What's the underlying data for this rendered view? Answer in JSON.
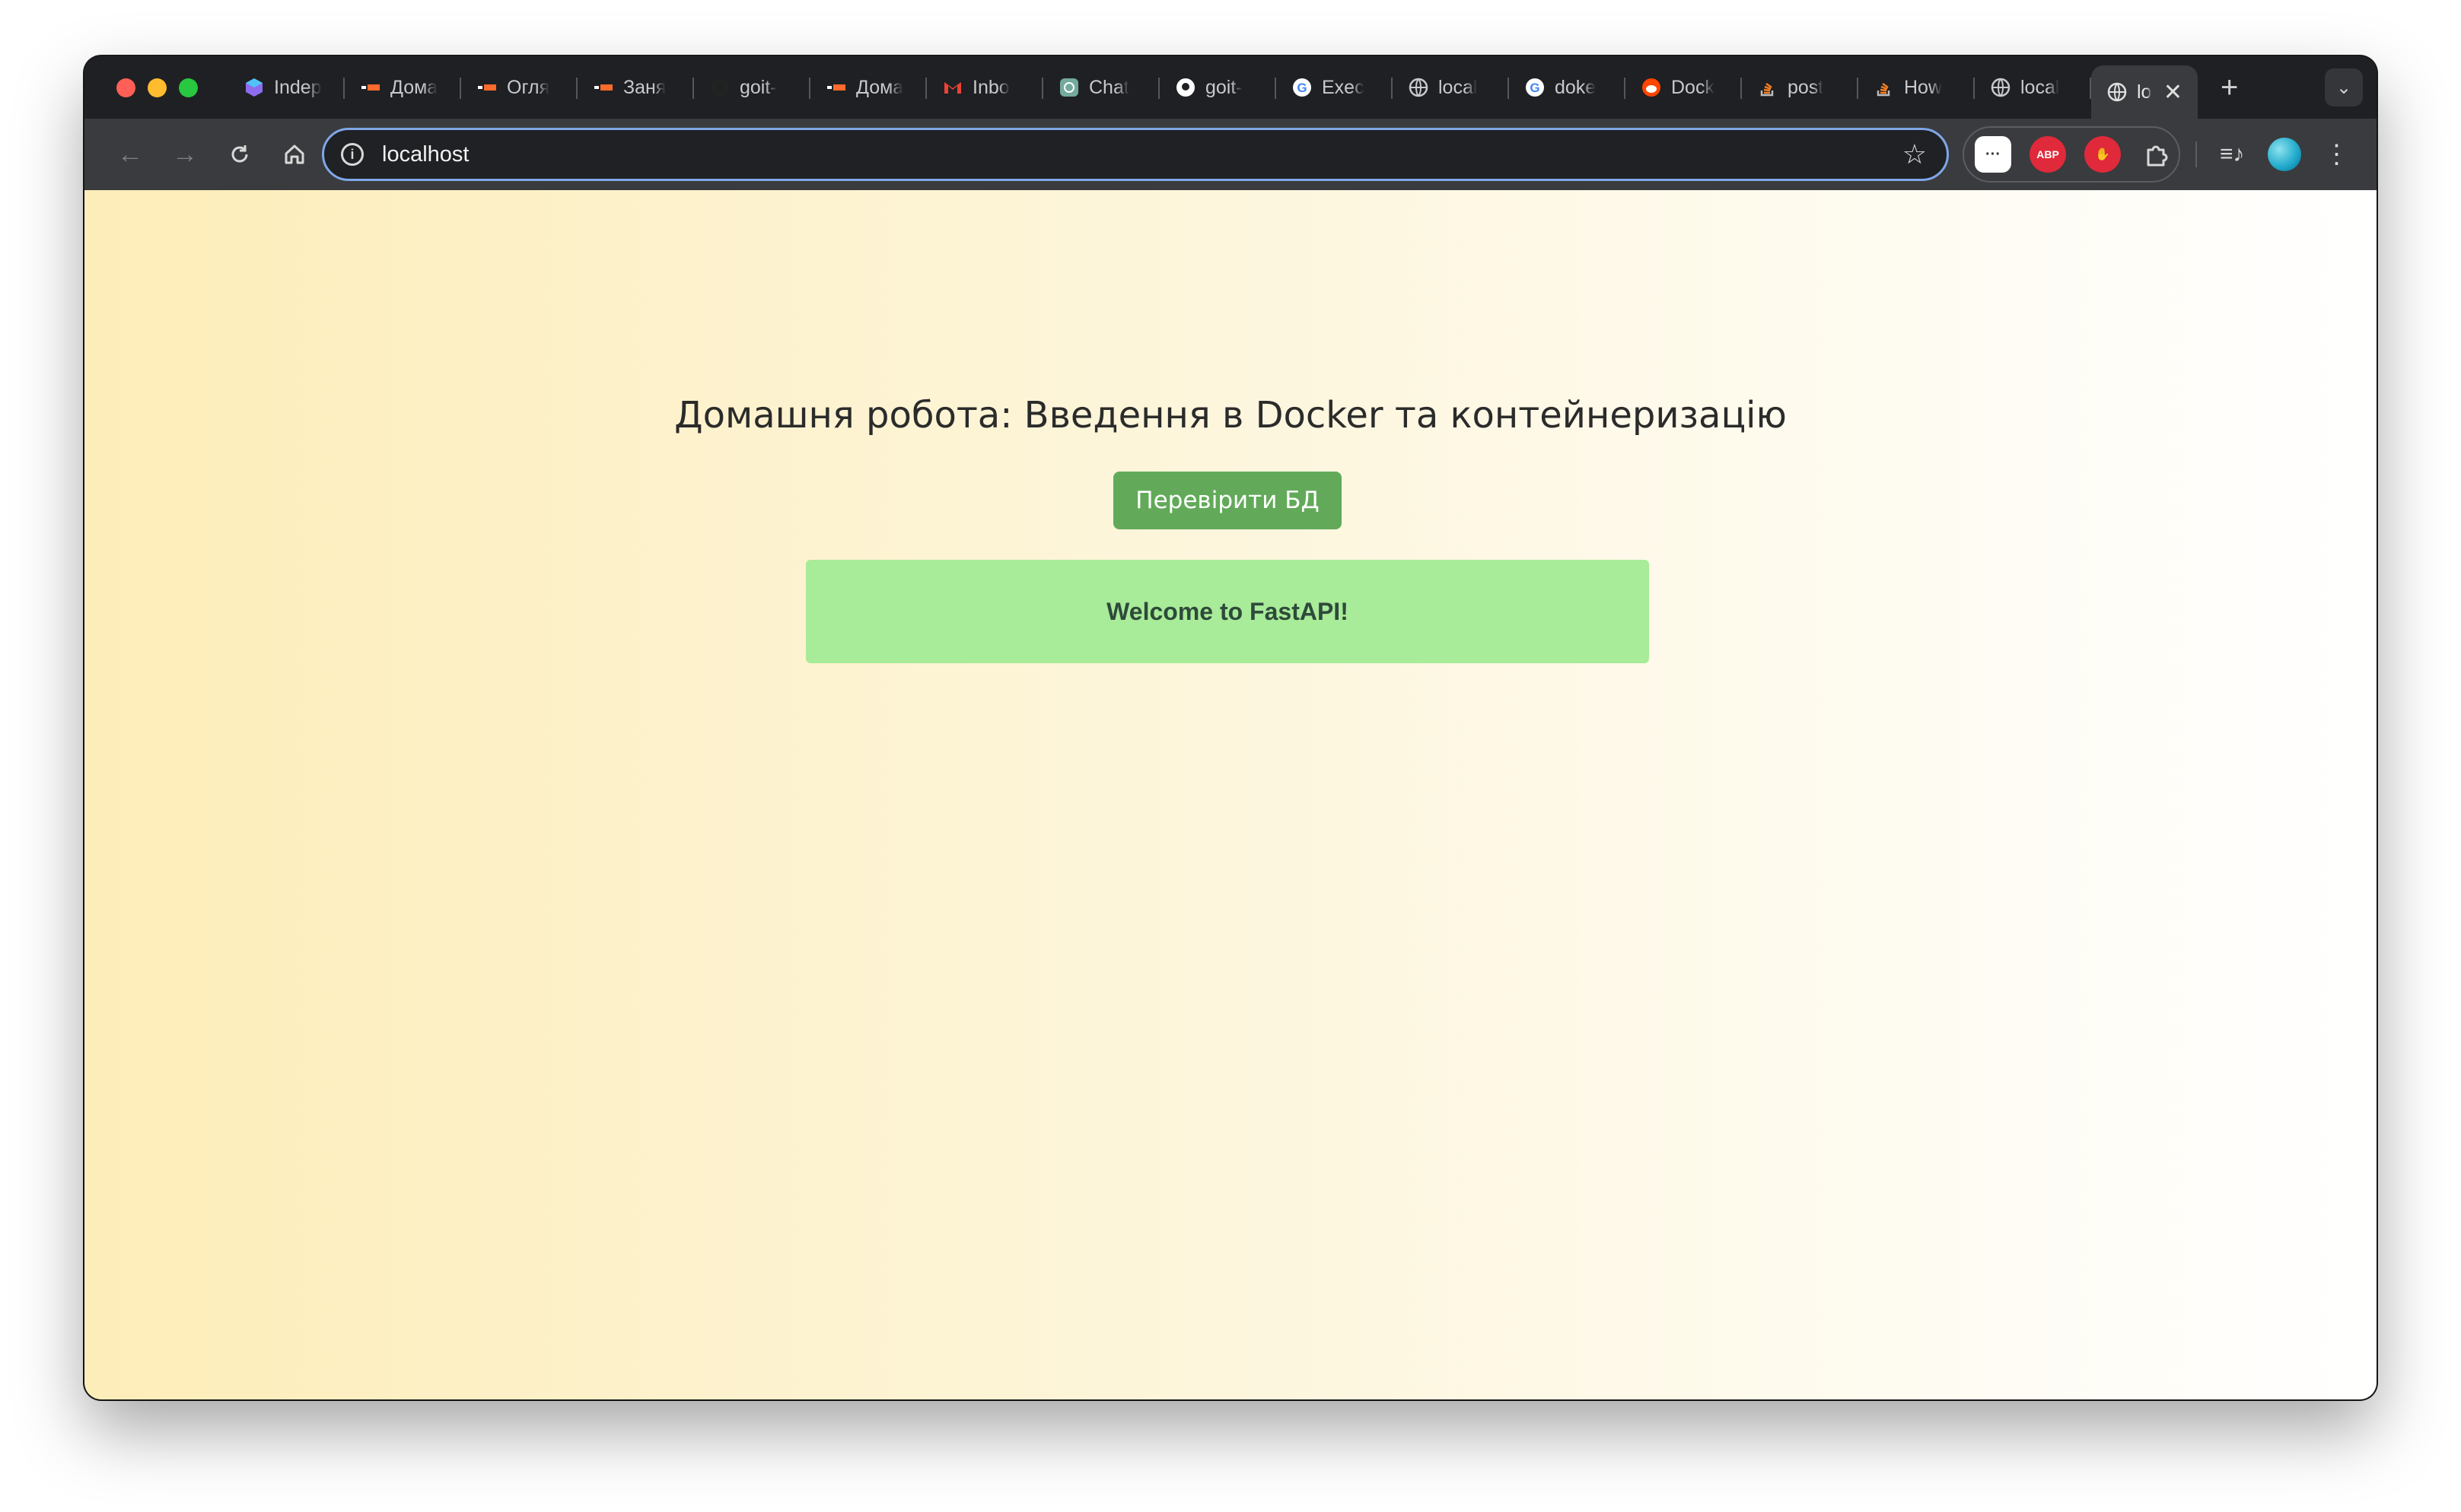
{
  "colors": {
    "close": "#ff5f57",
    "minimize": "#febc2e",
    "maximize": "#28c840",
    "button_green": "#62aa59",
    "message_bg": "#a8eb98"
  },
  "tabs": [
    {
      "title": "Indep",
      "icon": "hexagon-icon",
      "color": "#8e6cf0"
    },
    {
      "title": "Дома",
      "icon": "goit-icon",
      "color": "#ff6b2c"
    },
    {
      "title": "Огля",
      "icon": "goit-icon",
      "color": "#ff6b2c"
    },
    {
      "title": "Заня",
      "icon": "goit-icon",
      "color": "#ff6b2c"
    },
    {
      "title": "goit-",
      "icon": "github-icon",
      "color": "#222222"
    },
    {
      "title": "Дома",
      "icon": "goit-icon",
      "color": "#ff6b2c"
    },
    {
      "title": "Inbo",
      "icon": "gmail-icon",
      "color": "#ea4335"
    },
    {
      "title": "Chat",
      "icon": "chatgpt-icon",
      "color": "#74aa9c"
    },
    {
      "title": "goit-",
      "icon": "github-icon",
      "color": "#ffffff"
    },
    {
      "title": "Exec",
      "icon": "google-icon",
      "color": "#4285f4"
    },
    {
      "title": "local",
      "icon": "globe-icon",
      "color": "#c8c9cc"
    },
    {
      "title": "doke",
      "icon": "google-icon",
      "color": "#4285f4"
    },
    {
      "title": "Dock",
      "icon": "reddit-icon",
      "color": "#ff4500"
    },
    {
      "title": "post",
      "icon": "stackoverflow-icon",
      "color": "#f48024"
    },
    {
      "title": "How",
      "icon": "stackoverflow-icon",
      "color": "#f48024"
    },
    {
      "title": "local",
      "icon": "globe-icon",
      "color": "#c8c9cc"
    }
  ],
  "active_tab": {
    "title": "lo",
    "icon": "globe-icon"
  },
  "toolbar": {
    "url": "localhost"
  },
  "extensions": [
    {
      "name": "chat-extension-icon",
      "label": "···",
      "color": "#ffffff"
    },
    {
      "name": "adblock-icon",
      "label": "ABP",
      "color": "#e0293a"
    },
    {
      "name": "hand-stop-icon",
      "label": "✋",
      "color": "#e0293a"
    }
  ],
  "page": {
    "heading": "Домашня робота: Введення в Docker та контейнеризацію",
    "check_button": "Перевірити БД",
    "message": "Welcome to FastAPI!"
  }
}
